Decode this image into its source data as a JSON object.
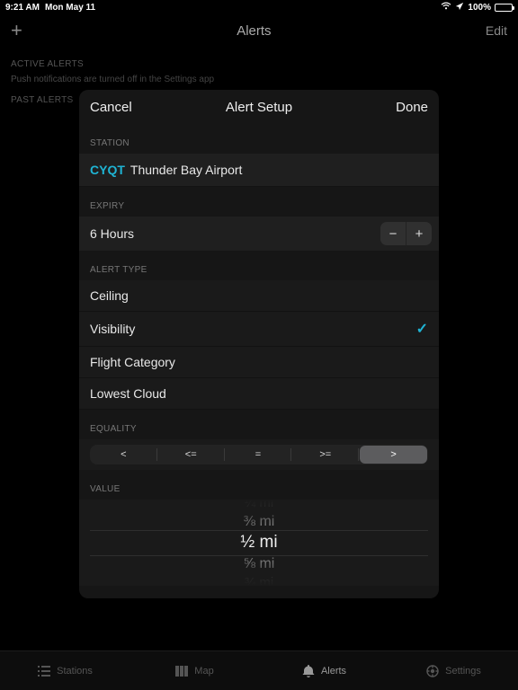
{
  "status_bar": {
    "time": "9:21 AM",
    "date": "Mon May 11",
    "wifi": "wifi-icon",
    "location": "location-icon",
    "battery_pct": "100%"
  },
  "bg": {
    "title": "Alerts",
    "edit": "Edit",
    "active_header": "ACTIVE ALERTS",
    "push_note": "Push notifications are turned off in the Settings app",
    "past_header": "PAST ALERTS"
  },
  "modal": {
    "cancel": "Cancel",
    "title": "Alert Setup",
    "done": "Done",
    "station_header": "STATION",
    "station_code": "CYQT",
    "station_name": "Thunder Bay Airport",
    "expiry_header": "EXPIRY",
    "expiry_value": "6 Hours",
    "alert_type_header": "ALERT TYPE",
    "alert_types": [
      "Ceiling",
      "Visibility",
      "Flight Category",
      "Lowest Cloud"
    ],
    "alert_type_selected": 1,
    "equality_header": "EQUALITY",
    "equality_options": [
      "<",
      "<=",
      "=",
      ">=",
      ">"
    ],
    "equality_selected": 4,
    "value_header": "VALUE",
    "picker_values": [
      "¼ mi",
      "⅜ mi",
      "½ mi",
      "⅝ mi",
      "¾ mi"
    ],
    "picker_selected": 2
  },
  "tabs": {
    "items": [
      {
        "label": "Stations",
        "icon": "list-icon"
      },
      {
        "label": "Map",
        "icon": "map-icon"
      },
      {
        "label": "Alerts",
        "icon": "bell-icon"
      },
      {
        "label": "Settings",
        "icon": "gear-icon"
      }
    ],
    "active": 2
  }
}
